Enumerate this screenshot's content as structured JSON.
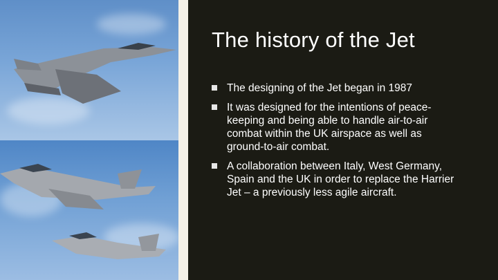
{
  "slide": {
    "title": "The history of the Jet",
    "bullets": [
      "The designing of the Jet began in 1987",
      "It was designed for the intentions of peace-keeping and being able to handle air-to-air combat within the UK airspace as well as ground-to-air combat.",
      "A collaboration between Italy, West Germany, Spain and the UK in order to replace the Harrier Jet – a previously less agile aircraft."
    ]
  },
  "colors": {
    "background": "#1b1b14",
    "text": "#ffffff",
    "accent_strip": "#f4f1e8",
    "sky": "#6f9fd4"
  },
  "images": {
    "top_photo": "eurofighter-jet-in-flight",
    "bottom_photo": "two-eurofighter-jets-in-formation"
  }
}
